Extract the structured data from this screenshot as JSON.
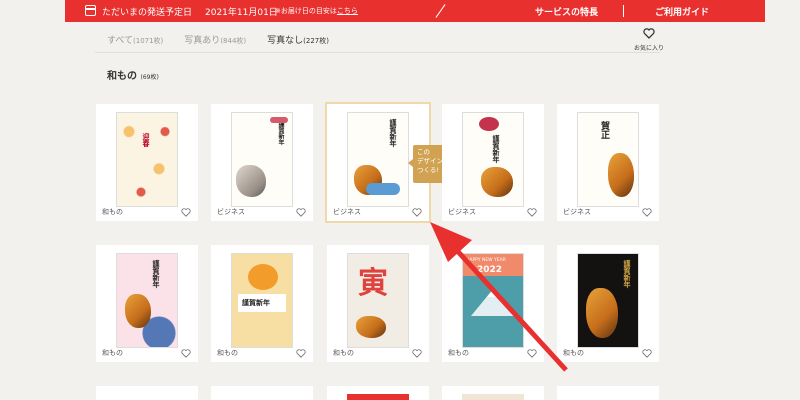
{
  "topbar": {
    "shipping_label": "ただいまの発送予定日",
    "shipping_date": "2021年11月01日",
    "note_prefix": "※お届け日の目安は",
    "note_link": "こちら",
    "nav_features": "サービスの特長",
    "nav_guide": "ご利用ガイド"
  },
  "tabs": [
    {
      "label": "すべて",
      "count": "(1071枚)"
    },
    {
      "label": "写真あり",
      "count": "(844枚)"
    },
    {
      "label": "写真なし",
      "count": "(227枚)"
    }
  ],
  "favorites_label": "お気に入り",
  "section": {
    "title": "和もの",
    "count": "(69枚)"
  },
  "tooltip": {
    "line1": "この",
    "line2": "デザインで",
    "line3": "つくる!"
  },
  "cards": [
    {
      "category": "和もの",
      "heading": "迎春"
    },
    {
      "category": "ビジネス",
      "heading": "謹賀新年"
    },
    {
      "category": "ビジネス",
      "heading": "謹賀新年"
    },
    {
      "category": "ビジネス",
      "heading": "謹賀新年"
    },
    {
      "category": "ビジネス",
      "heading": "賀正"
    },
    {
      "category": "和もの",
      "heading": "謹賀新年"
    },
    {
      "category": "和もの",
      "heading": "謹賀新年"
    },
    {
      "category": "和もの",
      "heading": "寅"
    },
    {
      "category": "和もの",
      "heading": "HAPPY NEW YEAR",
      "year": "2022"
    },
    {
      "category": "和もの",
      "heading": "謹賀新年"
    }
  ],
  "colors": {
    "accent": "#e8312f",
    "tooltip": "#d2a253",
    "arrow": "#e8312f",
    "selected_outline": "#f0d9a8"
  }
}
